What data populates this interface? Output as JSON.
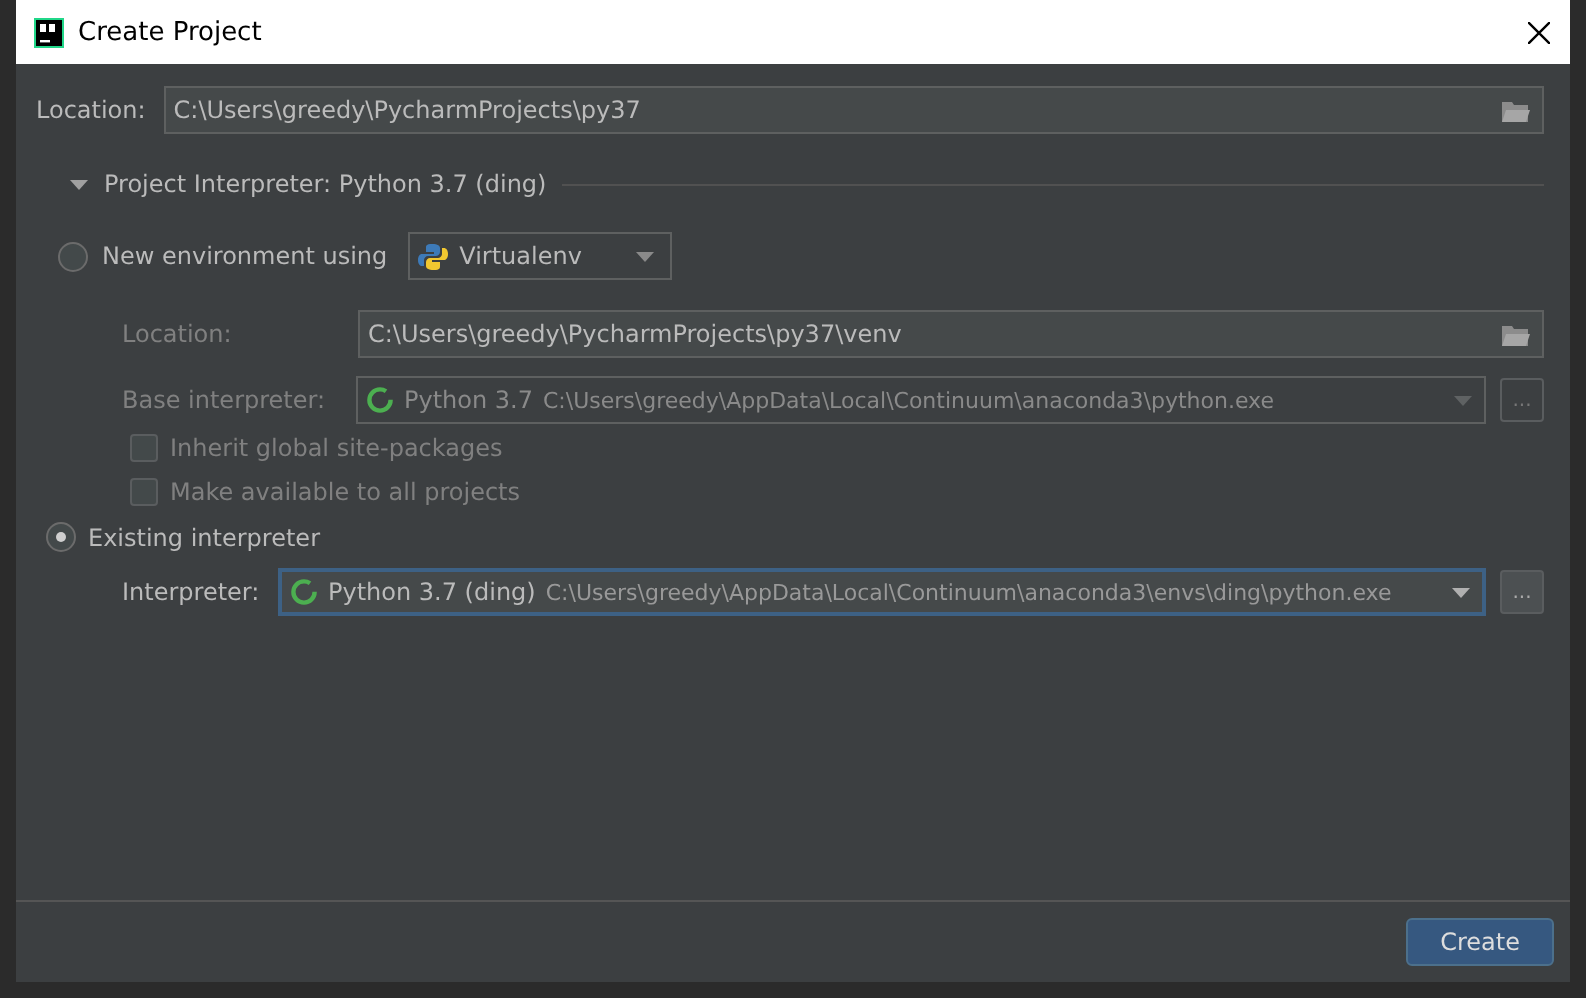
{
  "window": {
    "title": "Create Project"
  },
  "location": {
    "label": "Location:",
    "value": "C:\\Users\\greedy\\PycharmProjects\\py37"
  },
  "section": {
    "label": "Project Interpreter: Python 3.7 (ding)",
    "expanded": true
  },
  "new_environment": {
    "label": "New environment using",
    "selected": false,
    "tool": "Virtualenv",
    "location": {
      "label": "Location:",
      "value": "C:\\Users\\greedy\\PycharmProjects\\py37\\venv"
    },
    "base_interpreter": {
      "label": "Base interpreter:",
      "name": "Python 3.7",
      "path": "C:\\Users\\greedy\\AppData\\Local\\Continuum\\anaconda3\\python.exe",
      "button": "..."
    },
    "options": [
      {
        "label": "Inherit global site-packages",
        "checked": false
      },
      {
        "label": "Make available to all projects",
        "checked": false
      }
    ]
  },
  "existing_interpreter": {
    "label": "Existing interpreter",
    "selected": true,
    "interpreter": {
      "label": "Interpreter:",
      "name": "Python 3.7 (ding)",
      "path": "C:\\Users\\greedy\\AppData\\Local\\Continuum\\anaconda3\\envs\\ding\\python.exe",
      "button": "...",
      "focused": true
    }
  },
  "buttons": [
    {
      "label": "Create",
      "kind": "primary"
    }
  ]
}
